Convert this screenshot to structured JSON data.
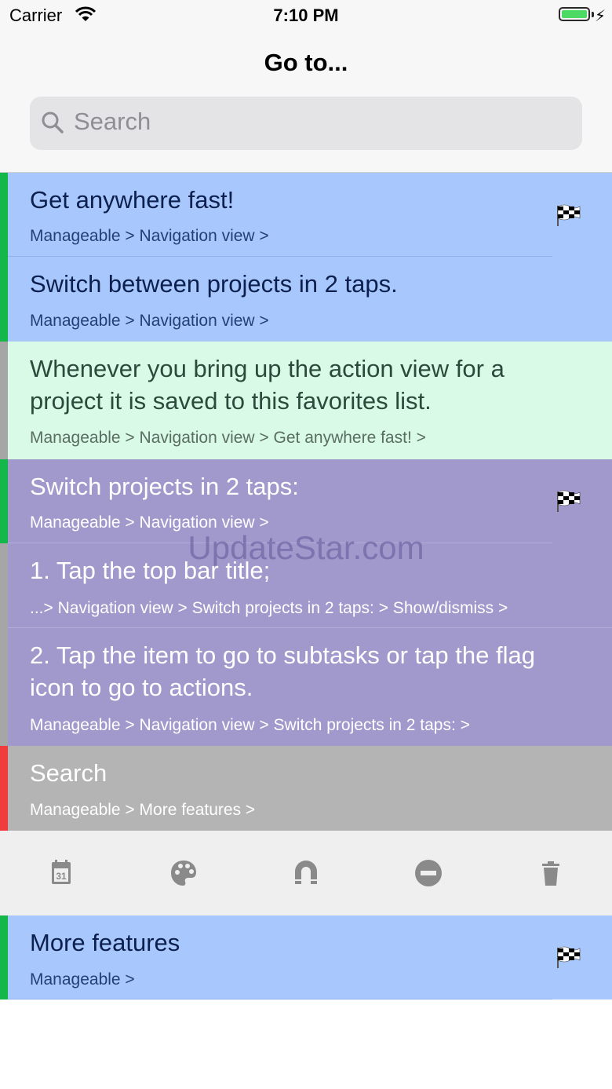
{
  "status_bar": {
    "carrier": "Carrier",
    "time": "7:10 PM",
    "icons": [
      "wifi-icon",
      "battery-icon",
      "charging-icon"
    ]
  },
  "header": {
    "title": "Go to...",
    "search": {
      "placeholder": "Search",
      "value": ""
    }
  },
  "rows": [
    {
      "title": "Get anywhere fast!",
      "path": "Manageable > Navigation view >",
      "accent": "#14b84a",
      "flag": true
    },
    {
      "title": "Switch between projects in 2 taps.",
      "path": "Manageable > Navigation view >",
      "accent": "#14b84a",
      "flag": false
    },
    {
      "title": "Whenever you bring up the action view for a project it is saved to this favorites list.",
      "path": "Manageable > Navigation view > Get anywhere fast! >",
      "accent": "#a6a6a6",
      "flag": false
    },
    {
      "title": "Switch projects in 2 taps:",
      "path": "Manageable > Navigation view >",
      "accent": "#14b84a",
      "flag": true
    },
    {
      "title": "1. Tap the top bar title;",
      "path": "...> Navigation view > Switch projects in 2 taps: > Show/dismiss >",
      "accent": "#a6a6a6",
      "flag": false
    },
    {
      "title": "2. Tap the item to go to subtasks or tap the flag icon to go to actions.",
      "path": "Manageable > Navigation view > Switch projects in 2 taps: >",
      "accent": "#a6a6a6",
      "flag": false
    },
    {
      "title": "Search",
      "path": "Manageable > More features >",
      "accent": "#f03c3c",
      "flag": false
    },
    {
      "title": "More features",
      "path": "Manageable >",
      "accent": "#14b84a",
      "flag": true
    }
  ],
  "toolbar": {
    "actions": [
      "calendar-icon",
      "palette-icon",
      "magnet-icon",
      "remove-icon",
      "trash-icon"
    ]
  },
  "watermark": "UpdateStar.com"
}
